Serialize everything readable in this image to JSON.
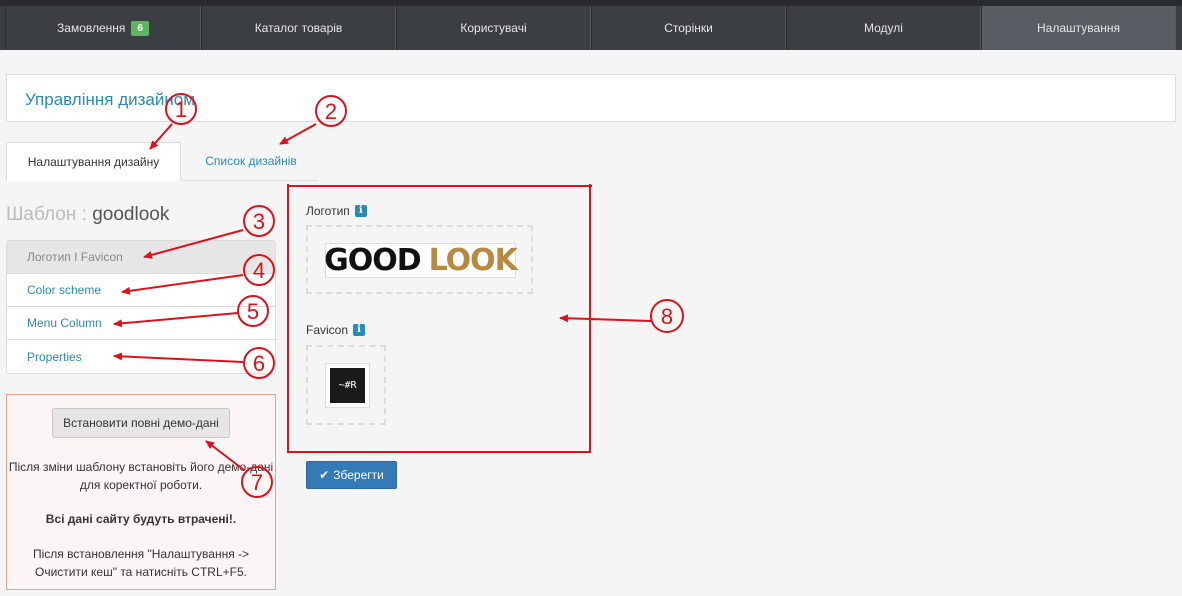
{
  "topnav": {
    "items": [
      {
        "label": "Замовлення",
        "badge": "6"
      },
      {
        "label": "Каталог товарів"
      },
      {
        "label": "Користувачі"
      },
      {
        "label": "Сторінки"
      },
      {
        "label": "Модулі"
      },
      {
        "label": "Налаштування"
      }
    ]
  },
  "page": {
    "title": "Управління дизайном"
  },
  "tabs": [
    {
      "label": "Налаштування дизайну"
    },
    {
      "label": "Список дизайнів"
    }
  ],
  "template": {
    "label": "Шаблон : ",
    "name": "goodlook"
  },
  "side_menu": [
    {
      "label": "Логотип I Favicon"
    },
    {
      "label": "Color scheme"
    },
    {
      "label": "Menu Column"
    },
    {
      "label": "Properties"
    }
  ],
  "demo": {
    "button": "Встановити повні демо-дані",
    "text1": "Після зміни шаблону встановіть його демо-дані для коректної роботи.",
    "text2": "Всі дані сайту будуть втрачені!.",
    "text3": "Після встановлення \"Налаштування -> Очистити кеш\" та натисніть CTRL+F5."
  },
  "logo": {
    "label": "Логотип",
    "image_text_1": "GOOD",
    "image_text_2": "LOOK"
  },
  "favicon": {
    "label": "Favicon",
    "image_text": "~#R"
  },
  "info_icon": "i",
  "save_button": "Зберегти",
  "annotations": [
    "1",
    "2",
    "3",
    "4",
    "5",
    "6",
    "7",
    "8"
  ],
  "colors": {
    "accent": "#2a8ab8",
    "annotation": "#e0101a",
    "badge": "#5cb85c",
    "nav_bg": "#3b3e42"
  }
}
